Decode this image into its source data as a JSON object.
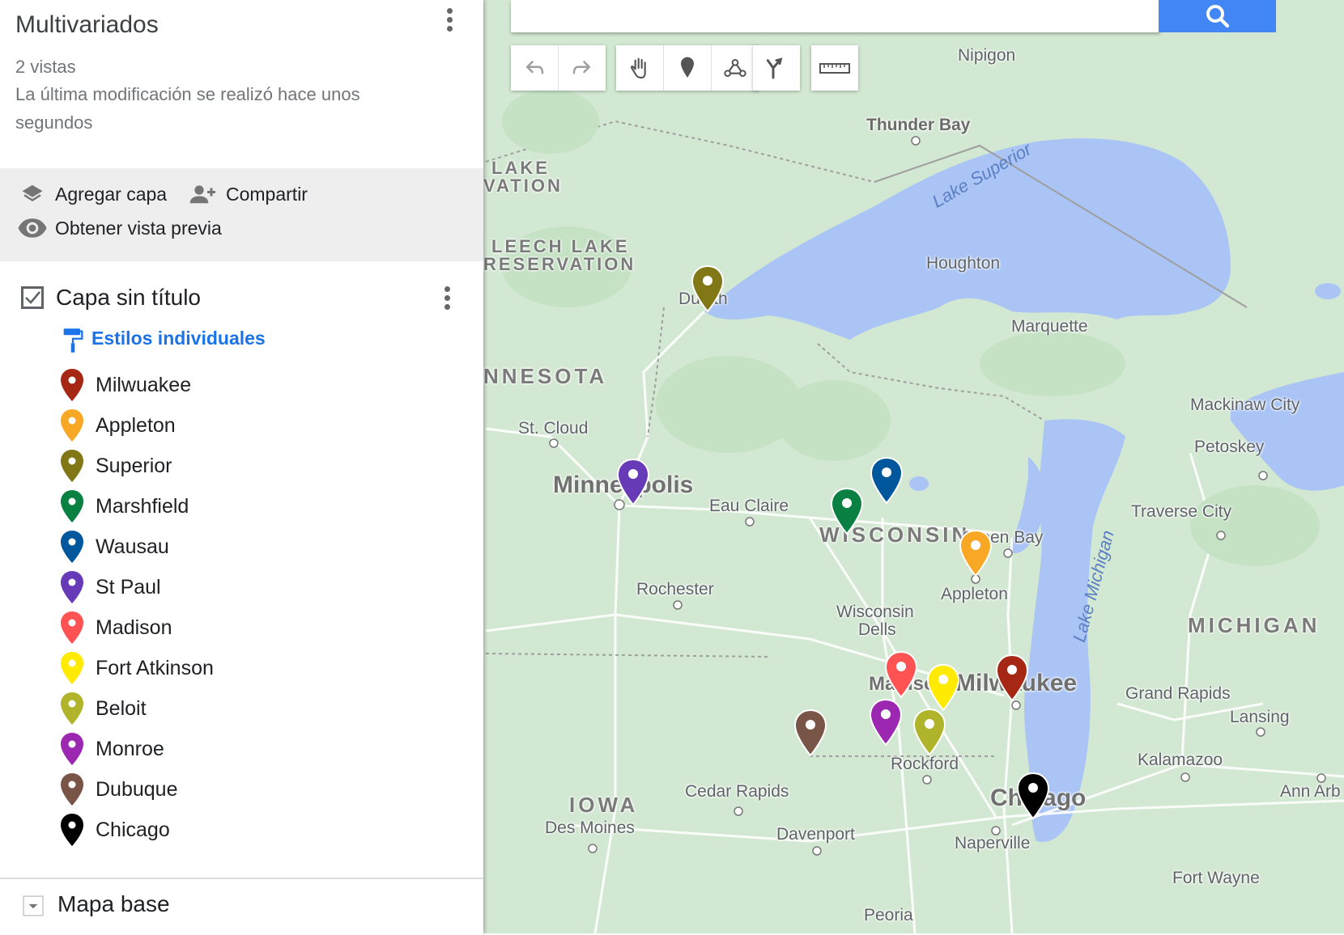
{
  "panel": {
    "title": "Multivariados",
    "views": "2 vistas",
    "modified": "La última modificación se realizó hace unos",
    "modified2": "segundos",
    "actions": {
      "add_layer": "Agregar capa",
      "share": "Compartir",
      "preview": "Obtener vista previa"
    },
    "layer": {
      "title": "Capa sin título",
      "checked": true,
      "style_link": "Estilos individuales",
      "items": [
        {
          "label": "Milwuakee",
          "color": "#a52714"
        },
        {
          "label": "Appleton",
          "color": "#f9a825"
        },
        {
          "label": "Superior",
          "color": "#817717"
        },
        {
          "label": "Marshfield",
          "color": "#0b8043"
        },
        {
          "label": "Wausau",
          "color": "#01579b"
        },
        {
          "label": "St Paul",
          "color": "#673ab7"
        },
        {
          "label": "Madison",
          "color": "#ff5252"
        },
        {
          "label": "Fort Atkinson",
          "color": "#ffea00"
        },
        {
          "label": "Beloit",
          "color": "#afb42b"
        },
        {
          "label": "Monroe",
          "color": "#9c27b0"
        },
        {
          "label": "Dubuque",
          "color": "#795548"
        },
        {
          "label": "Chicago",
          "color": "#000000"
        }
      ]
    },
    "base_map": "Mapa base"
  },
  "map_labels": {
    "nipigon": "Nipigon",
    "thunder_bay": "Thunder Bay",
    "lake_superior": "Lake Superior",
    "houghton": "Houghton",
    "marquette": "Marquette",
    "lake_res": "LAKE",
    "vation": "VATION",
    "leech_lake": "LEECH LAKE",
    "reservation": "RESERVATION",
    "duluth": "Duluth",
    "nnesota": "NNESOTA",
    "st_cloud": "St. Cloud",
    "minneapolis": "Minneapolis",
    "eau_claire": "Eau Claire",
    "wisconsin": "WISCONSIN",
    "green_bay": "Green Bay",
    "appleton": "Appleton",
    "rochester": "Rochester",
    "wisconsin_dells": "Wisconsin",
    "dells": "Dells",
    "madison": "Madison",
    "milwaukee": "Milwaukee",
    "rockford": "Rockford",
    "lake_michigan": "Lake Michigan",
    "mackinaw": "Mackinaw City",
    "petoskey": "Petoskey",
    "traverse": "Traverse City",
    "michigan": "MICHIGAN",
    "grand_rapids": "Grand Rapids",
    "lansing": "Lansing",
    "kalamazoo": "Kalamazoo",
    "ann_arbor": "Ann Arb",
    "iowa": "IOWA",
    "des_moines": "Des Moines",
    "cedar_rapids": "Cedar Rapids",
    "davenport": "Davenport",
    "chicago": "Chicago",
    "naperville": "Naperville",
    "fort_wayne": "Fort Wayne",
    "peoria": "Peoria"
  },
  "markers": [
    {
      "name": "Superior",
      "color": "#817717"
    },
    {
      "name": "St Paul",
      "color": "#673ab7"
    },
    {
      "name": "Marshfield",
      "color": "#0b8043"
    },
    {
      "name": "Wausau",
      "color": "#01579b"
    },
    {
      "name": "Appleton",
      "color": "#f9a825"
    },
    {
      "name": "Madison",
      "color": "#ff5252"
    },
    {
      "name": "Fort Atkinson",
      "color": "#ffea00"
    },
    {
      "name": "Milwuakee",
      "color": "#a52714"
    },
    {
      "name": "Monroe",
      "color": "#9c27b0"
    },
    {
      "name": "Beloit",
      "color": "#afb42b"
    },
    {
      "name": "Dubuque",
      "color": "#795548"
    },
    {
      "name": "Chicago",
      "color": "#000000"
    }
  ],
  "toolbar": [
    "undo-icon",
    "redo-icon",
    "hand-icon",
    "marker-icon",
    "line-icon",
    "route-icon",
    "ruler-icon"
  ],
  "colors": {
    "search_button": "#4285f4",
    "link": "#1a73e8",
    "water": "#aac4f5",
    "land": "#d3e8d2"
  }
}
